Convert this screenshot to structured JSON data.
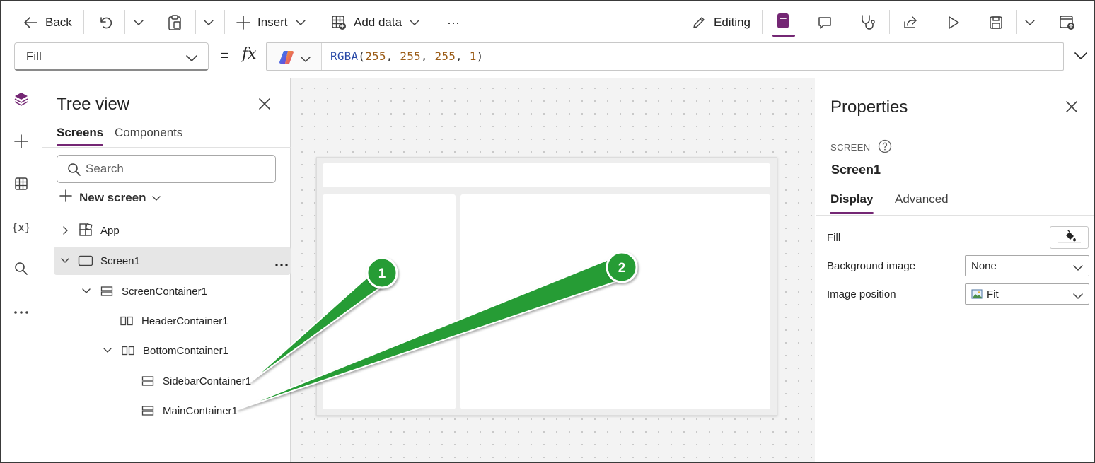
{
  "toolbar": {
    "back_label": "Back",
    "insert_label": "Insert",
    "add_data_label": "Add data",
    "more_label": "···",
    "editing_label": "Editing"
  },
  "formula_bar": {
    "property": "Fill",
    "equals": "=",
    "fx": "fx",
    "formula_fn": "RGBA",
    "formula_args": [
      "255",
      "255",
      "255",
      "1"
    ]
  },
  "tree_view": {
    "title": "Tree view",
    "tabs": [
      {
        "label": "Screens",
        "active": true
      },
      {
        "label": "Components",
        "active": false
      }
    ],
    "search_placeholder": "Search",
    "new_screen_label": "New screen",
    "nodes": [
      {
        "label": "App",
        "level": 0,
        "expanded": false,
        "icon": "app-icon"
      },
      {
        "label": "Screen1",
        "level": 0,
        "expanded": true,
        "icon": "screen-icon",
        "selected": true
      },
      {
        "label": "ScreenContainer1",
        "level": 1,
        "expanded": true,
        "icon": "vertical-container-icon"
      },
      {
        "label": "HeaderContainer1",
        "level": 2,
        "icon": "horizontal-container-icon"
      },
      {
        "label": "BottomContainer1",
        "level": 2,
        "expanded": true,
        "icon": "horizontal-container-icon"
      },
      {
        "label": "SidebarContainer1",
        "level": 3,
        "icon": "vertical-container-icon"
      },
      {
        "label": "MainContainer1",
        "level": 3,
        "icon": "vertical-container-icon"
      }
    ]
  },
  "properties": {
    "title": "Properties",
    "type_label": "SCREEN",
    "name": "Screen1",
    "tabs": [
      {
        "label": "Display",
        "active": true
      },
      {
        "label": "Advanced",
        "active": false
      }
    ],
    "rows": [
      {
        "label": "Fill"
      },
      {
        "label": "Background image",
        "value": "None"
      },
      {
        "label": "Image position",
        "value": "Fit"
      }
    ]
  },
  "callouts": {
    "one": "1",
    "two": "2"
  },
  "colors": {
    "accent": "#742774",
    "callout_green": "#259c35",
    "canvas_bg": "#f3f3f3"
  }
}
